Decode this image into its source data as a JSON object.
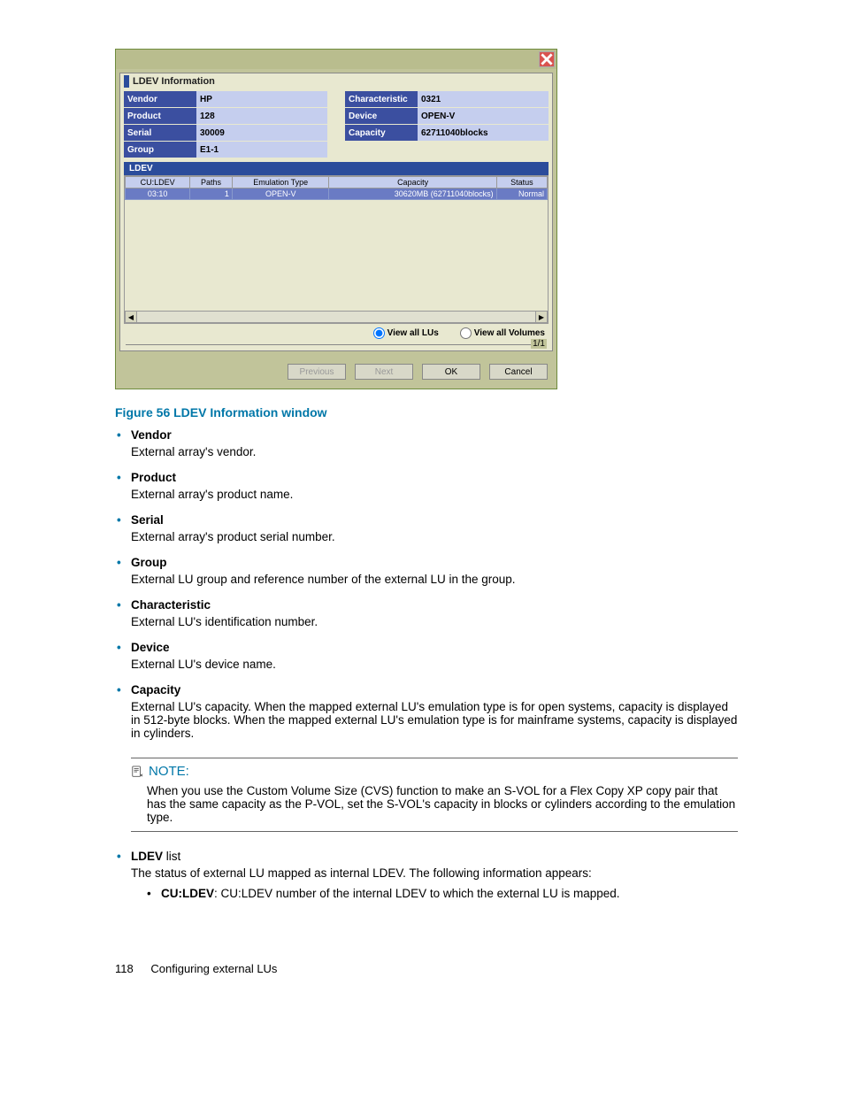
{
  "dialog": {
    "panel_title": "LDEV Information",
    "info_left": [
      {
        "label": "Vendor",
        "value": "HP"
      },
      {
        "label": "Product",
        "value": "128"
      },
      {
        "label": "Serial",
        "value": "30009"
      },
      {
        "label": "Group",
        "value": "E1-1"
      }
    ],
    "info_right": [
      {
        "label": "Characteristic",
        "value": "0321"
      },
      {
        "label": "Device",
        "value": "OPEN-V"
      },
      {
        "label": "Capacity",
        "value": "62711040blocks"
      }
    ],
    "ldev_section_label": "LDEV",
    "table": {
      "headers": [
        "CU:LDEV",
        "Paths",
        "Emulation Type",
        "Capacity",
        "Status"
      ],
      "row": {
        "culdev": "03:10",
        "paths": "1",
        "emu": "OPEN-V",
        "cap": "30620MB (62711040blocks)",
        "status": "Normal"
      }
    },
    "radios": {
      "view_lus": "View all LUs",
      "view_vols": "View all Volumes"
    },
    "pager": "1/1",
    "buttons": {
      "prev": "Previous",
      "next": "Next",
      "ok": "OK",
      "cancel": "Cancel"
    }
  },
  "caption": "Figure 56 LDEV Information window",
  "defs": [
    {
      "term": "Vendor",
      "desc": "External array's vendor."
    },
    {
      "term": "Product",
      "desc": "External array's product name."
    },
    {
      "term": "Serial",
      "desc": "External array's product serial number."
    },
    {
      "term": "Group",
      "desc": "External LU group and reference number of the external LU in the group."
    },
    {
      "term": "Characteristic",
      "desc": "External LU's identification number."
    },
    {
      "term": "Device",
      "desc": "External LU's device name."
    },
    {
      "term": "Capacity",
      "desc": "External LU's capacity. When the mapped external LU's emulation type is for open systems, capacity is displayed in 512-byte blocks. When the mapped external LU's emulation type is for mainframe systems, capacity is displayed in cylinders."
    }
  ],
  "note": {
    "head": "NOTE:",
    "body": "When you use the Custom Volume Size (CVS) function to make an S-VOL for a Flex Copy XP copy pair that has the same capacity as the P-VOL, set the S-VOL's capacity in blocks or cylinders according to the emulation type."
  },
  "ldev_list": {
    "term_bold": "LDEV",
    "term_rest": " list",
    "desc": "The status of external LU mapped as internal LDEV. The following information appears:",
    "sub_bold": "CU:LDEV",
    "sub_rest": ": CU:LDEV number of the internal LDEV to which the external LU is mapped."
  },
  "footer": {
    "page": "118",
    "title": "Configuring external LUs"
  }
}
